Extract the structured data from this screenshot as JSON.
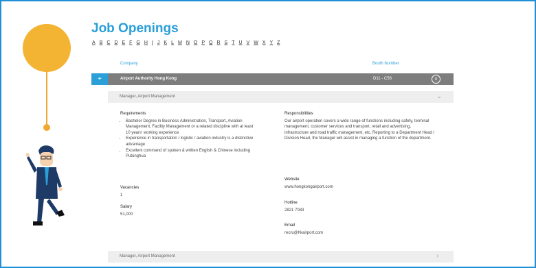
{
  "page": {
    "title": "Job Openings",
    "alphabet": [
      "A",
      "B",
      "C",
      "D",
      "E",
      "F",
      "G",
      "H",
      "I",
      "J",
      "K",
      "L",
      "M",
      "N",
      "O",
      "P",
      "Q",
      "R",
      "S",
      "T",
      "U",
      "V",
      "W",
      "X",
      "Y",
      "Z"
    ]
  },
  "table": {
    "col_company": "Company",
    "col_booth": "Booth Number"
  },
  "company": {
    "name": "Airport Authority Hong Kong",
    "booth": "D11 - C56",
    "expand_icon": "+",
    "close_icon": "x"
  },
  "job1": {
    "title": "Manager, Airport Management",
    "requirements_label": "Requirements",
    "requirements": [
      "Bachelor Degree in Business Administration, Transport, Aviation Management, Facility Management or a related discipline with at least 10 years' working experience",
      "Experience in transportation / logistic / aviation industry is a distinctive advantage",
      "Excellent command of spoken & written English & Chinese including Putonghua"
    ],
    "vacancies_label": "Vacancies",
    "vacancies": "1",
    "salary_label": "Salary",
    "salary": "51,000",
    "responsibilities_label": "Responsibilities",
    "responsibilities": "Our airport operation covers a wide range of functions including safety, terminal management, customer services and transport, retail and advertising, infrastructure and road traffic management, etc. Reporting to a Department Head / Division Head, the Manager will assist in managing a function of the department.",
    "website_label": "Website",
    "website": "www.hongkongairport.com",
    "hotline_label": "Hotline",
    "hotline": "2821 7083",
    "email_label": "Email",
    "email": "recru@hkairport.com"
  },
  "job2": {
    "title": "Manager, Airport Management"
  }
}
